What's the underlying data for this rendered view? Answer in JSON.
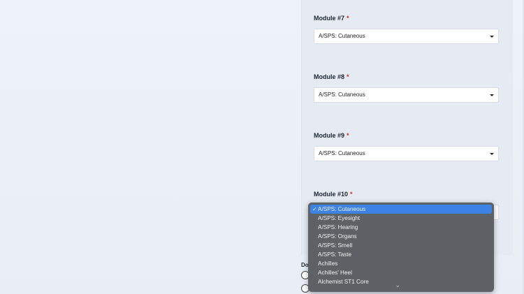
{
  "modules": [
    {
      "label": "Module #7",
      "required_mark": "*",
      "value": "A/SPS: Cutaneous"
    },
    {
      "label": "Module #8",
      "required_mark": "*",
      "value": "A/SPS: Cutaneous"
    },
    {
      "label": "Module #9",
      "required_mark": "*",
      "value": "A/SPS: Cutaneous"
    },
    {
      "label": "Module #10",
      "required_mark": "*"
    }
  ],
  "dropdown": {
    "selected_check": "✓",
    "options": [
      "A/SPS: Cutaneous",
      "A/SPS: Eyesight",
      "A/SPS: Hearing",
      "A/SPS: Organs",
      "A/SPS: Smell",
      "A/SPS: Taste",
      "Achilles",
      "Achilles' Heel",
      "Alchemist ST1 Core"
    ],
    "scroll_indicator": "⌄"
  },
  "partial": {
    "label": "Do"
  },
  "colors": {
    "accent": "#3d83e6",
    "required": "#d0342c",
    "menu_bg": "#5e6266"
  }
}
